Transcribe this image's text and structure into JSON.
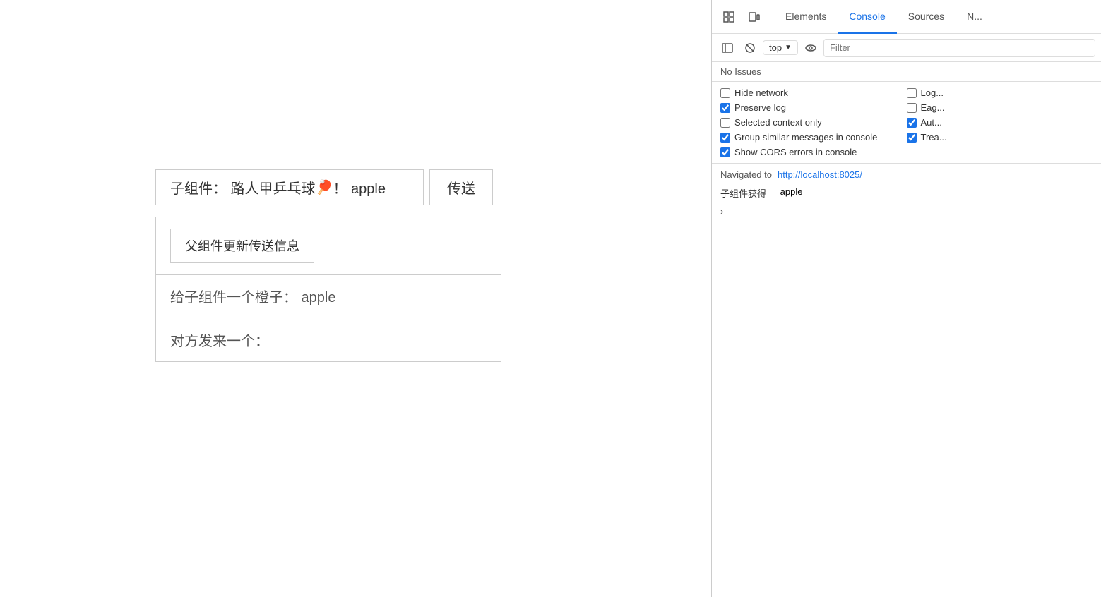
{
  "page": {
    "child_component_text": "子组件：  路人甲乒乓球",
    "child_emoji": "🏓",
    "child_exclaim": "！  apple",
    "send_button_label": "传送",
    "parent_update_button_label": "父组件更新传送信息",
    "parent_orange_text": "给子组件一个橙子：  apple",
    "parent_receive_text": "对方发来一个："
  },
  "devtools": {
    "tabs": [
      {
        "id": "elements",
        "label": "Elements",
        "active": false
      },
      {
        "id": "console",
        "label": "Console",
        "active": true
      },
      {
        "id": "sources",
        "label": "Sources",
        "active": false
      },
      {
        "id": "network",
        "label": "N...",
        "active": false
      }
    ],
    "toolbar": {
      "top_label": "top",
      "filter_placeholder": "Filter"
    },
    "issues_label": "No Issues",
    "options": [
      {
        "id": "hide-network",
        "label": "Hide network",
        "checked": false
      },
      {
        "id": "log-xpath",
        "label": "Log...",
        "checked": false
      },
      {
        "id": "preserve-log",
        "label": "Preserve log",
        "checked": true
      },
      {
        "id": "eager-eval",
        "label": "Eag...",
        "checked": false
      },
      {
        "id": "selected-context",
        "label": "Selected context only",
        "checked": false
      },
      {
        "id": "auto-complete",
        "label": "Aut...",
        "checked": true
      },
      {
        "id": "group-similar",
        "label": "Group similar messages in console",
        "checked": true
      },
      {
        "id": "treat-as",
        "label": "Trea...",
        "checked": true
      },
      {
        "id": "show-cors",
        "label": "Show CORS errors in console",
        "checked": true
      }
    ],
    "log_entries": [
      {
        "id": "navigated",
        "prefix": "Navigated to ",
        "url": "http://localhost:8025/",
        "type": "navigated"
      },
      {
        "id": "child-got",
        "text": "子组件获得",
        "value": "apple",
        "type": "console-log"
      }
    ]
  }
}
